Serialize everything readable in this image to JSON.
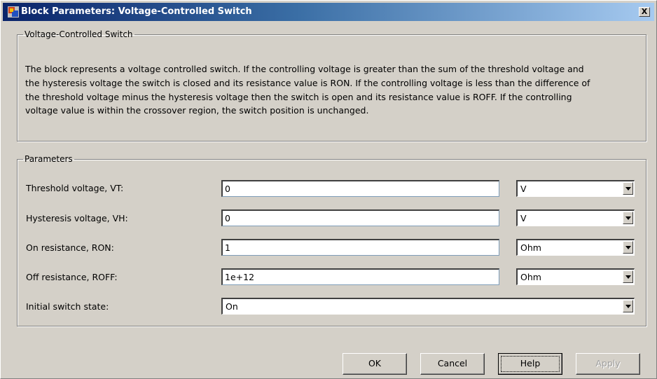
{
  "window": {
    "title": "Block Parameters: Voltage-Controlled Switch",
    "close_label": "X"
  },
  "description_group": {
    "legend": "Voltage-Controlled Switch",
    "lines": [
      "The block represents a voltage controlled switch. If the controlling voltage is greater than the sum of the threshold voltage and",
      "the hysteresis voltage the switch is closed and its resistance value is RON. If the controlling voltage is less than the difference of",
      "the threshold voltage minus the hysteresis voltage then the switch is open and its resistance value is ROFF. If the controlling",
      "voltage value is within the crossover region, the switch position is unchanged."
    ]
  },
  "parameters": {
    "legend": "Parameters",
    "threshold": {
      "label": "Threshold voltage, VT:",
      "value": "0",
      "unit": "V"
    },
    "hysteresis": {
      "label": "Hysteresis voltage, VH:",
      "value": "0",
      "unit": "V"
    },
    "ron": {
      "label": "On resistance, RON:",
      "value": "1",
      "unit": "Ohm"
    },
    "roff": {
      "label": "Off resistance, ROFF:",
      "value": "1e+12",
      "unit": "Ohm"
    },
    "initial_state": {
      "label": "Initial switch state:",
      "value": "On"
    }
  },
  "buttons": {
    "ok": "OK",
    "cancel": "Cancel",
    "help": "Help",
    "apply": "Apply"
  },
  "icons": {
    "title_icon": "simulink-block-icon",
    "dropdown_icon": "chevron-down-icon"
  }
}
